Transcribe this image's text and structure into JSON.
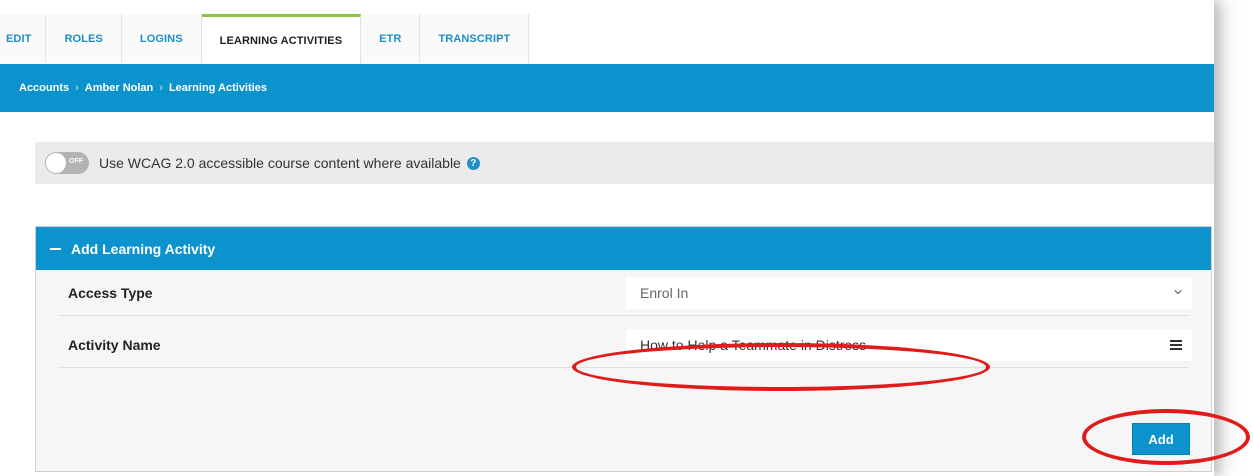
{
  "tabs": [
    {
      "label": "EDIT"
    },
    {
      "label": "ROLES"
    },
    {
      "label": "LOGINS"
    },
    {
      "label": "LEARNING ACTIVITIES"
    },
    {
      "label": "ETR"
    },
    {
      "label": "TRANSCRIPT"
    }
  ],
  "active_tab": "LEARNING ACTIVITIES",
  "breadcrumb": [
    "Accounts",
    "Amber Nolan",
    "Learning Activities"
  ],
  "breadcrumb_separator": "›",
  "wcag": {
    "toggle_state": "OFF",
    "text": "Use WCAG 2.0 accessible course content where available",
    "help_icon": "question-circle-icon"
  },
  "panel": {
    "title": "Add Learning Activity",
    "collapse_icon": "minus-icon",
    "fields": {
      "access_type_label": "Access Type",
      "access_type_value": "Enrol In",
      "activity_name_label": "Activity Name",
      "activity_name_value": "How to Help a Teammate in Distress"
    },
    "add_button": "Add"
  },
  "colors": {
    "brand_blue": "#0c93cd",
    "active_tab_accent": "#8cc63e",
    "annotation_red": "#e01b1b"
  }
}
